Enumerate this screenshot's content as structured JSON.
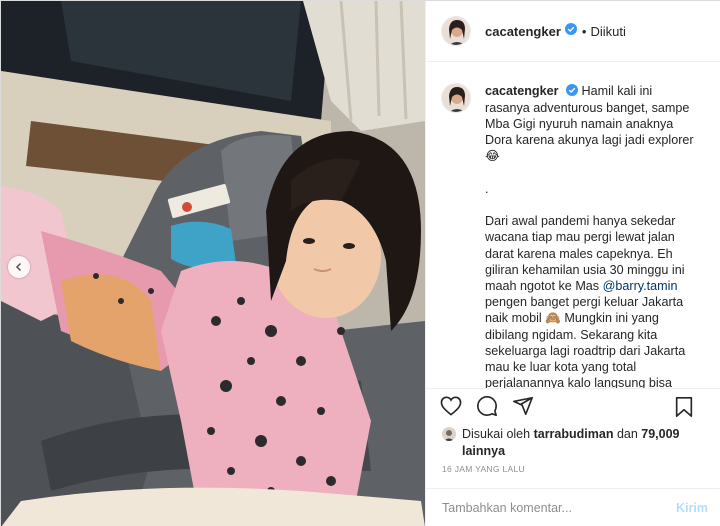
{
  "post": {
    "username": "cacatengker",
    "follow_status": "Diikuti",
    "dot": "•",
    "verified_icon": "verified-badge-icon"
  },
  "caption": {
    "username": "cacatengker",
    "text_line1": "Hamil kali ini rasanya adventurous banget, sampe Mba Gigi nyuruh namain anaknya Dora karena akunya lagi jadi explorer 😂\n\n.\n\nDari awal pandemi hanya sekedar wacana tiap mau pergi lewat jalan darat karena males capeknya. Eh giliran kehamilan usia 30 minggu ini maah ngotot ke Mas ",
    "mention": "@barry.tamin",
    "text_line2": " pengen banget pergi keluar Jakarta naik mobil 🙈 Mungkin ini yang dibilang ngidam. Sekarang kita sekeluarga lagi roadtrip dari Jakarta mau ke luar kota yang total perjalanannya kalo langsung bisa seharian full. Akhirnya kita memilih"
  },
  "likes": {
    "prefix": "Disukai oleh ",
    "liker": "tarrabudiman",
    "middle": " dan ",
    "count": "79,009 lainnya"
  },
  "timestamp": "16 JAM YANG LALU",
  "comment_box": {
    "placeholder": "Tambahkan komentar...",
    "post_label": "Kirim"
  },
  "colors": {
    "verified": "#3897f0",
    "mention": "#00376b",
    "post_disabled": "#b2dffc",
    "muted": "#8e8e8e"
  }
}
